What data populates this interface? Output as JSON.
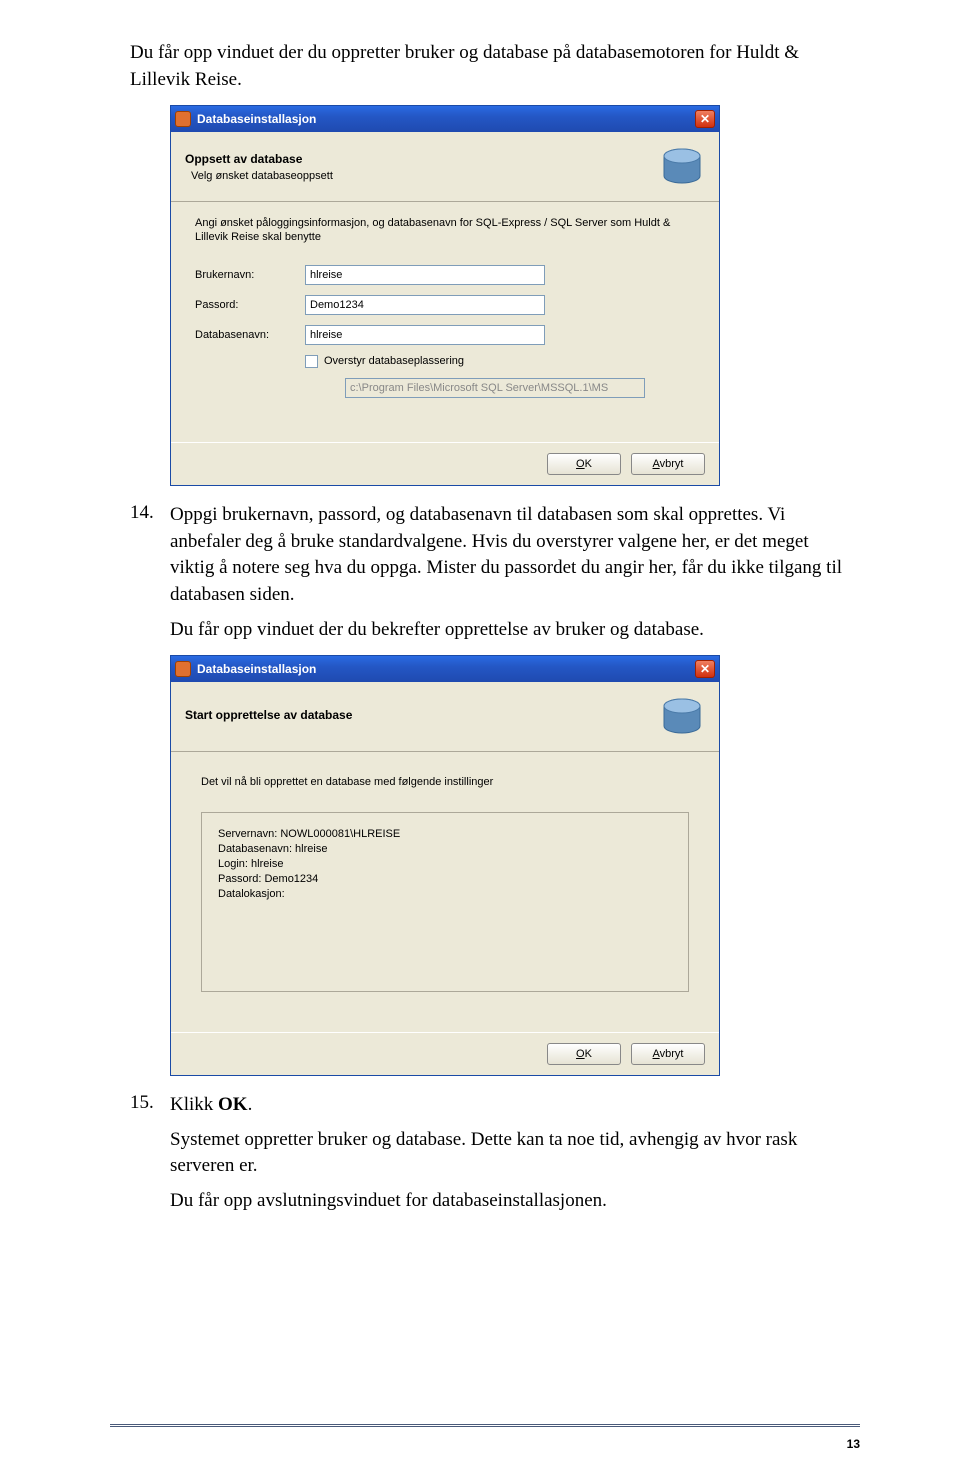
{
  "intro_text": "Du får opp vinduet der du oppretter bruker og database på databasemotoren for Huldt & Lillevik Reise.",
  "dialog1": {
    "title": "Databaseinstallasjon",
    "header_title": "Oppsett av database",
    "header_sub": "Velg ønsket databaseoppsett",
    "info": "Angi ønsket påloggingsinformasjon, og databasenavn for SQL-Express / SQL Server som Huldt & Lillevik Reise skal benytte",
    "row_user_label": "Brukernavn:",
    "row_user_value": "hlreise",
    "row_pass_label": "Passord:",
    "row_pass_value": "Demo1234",
    "row_db_label": "Databasenavn:",
    "row_db_value": "hlreise",
    "override_label": "Overstyr databaseplassering",
    "path_value": "c:\\Program Files\\Microsoft SQL Server\\MSSQL.1\\MS",
    "ok_label": "OK",
    "cancel_label": "Avbryt"
  },
  "step14": {
    "num": "14.",
    "text_a": "Oppgi brukernavn, passord, og databasenavn til databasen som skal opprettes. Vi anbefaler deg å bruke standardvalgene. Hvis du overstyrer valgene her, er det meget viktig å notere seg hva du oppga. Mister du passordet du angir her, får du ikke tilgang til databasen siden.",
    "text_b": "Du får opp vinduet der du bekrefter opprettelse av bruker og database."
  },
  "dialog2": {
    "title": "Databaseinstallasjon",
    "header_title": "Start opprettelse av database",
    "confirm_text": "Det vil nå bli opprettet en database med følgende instillinger",
    "line1": "Servernavn: NOWL000081\\HLREISE",
    "line2": "Databasenavn: hlreise",
    "line3": "Login: hlreise",
    "line4": "Passord: Demo1234",
    "line5": "Datalokasjon:",
    "ok_label": "OK",
    "cancel_label": "Avbryt"
  },
  "step15": {
    "num": "15.",
    "text_a_pre": "Klikk ",
    "text_a_bold": "OK",
    "text_a_post": ".",
    "text_b": "Systemet oppretter bruker og database. Dette kan ta noe tid, avhengig av hvor rask serveren er.",
    "text_c": "Du får opp avslutningsvinduet for databaseinstallasjonen."
  },
  "page_number": "13"
}
